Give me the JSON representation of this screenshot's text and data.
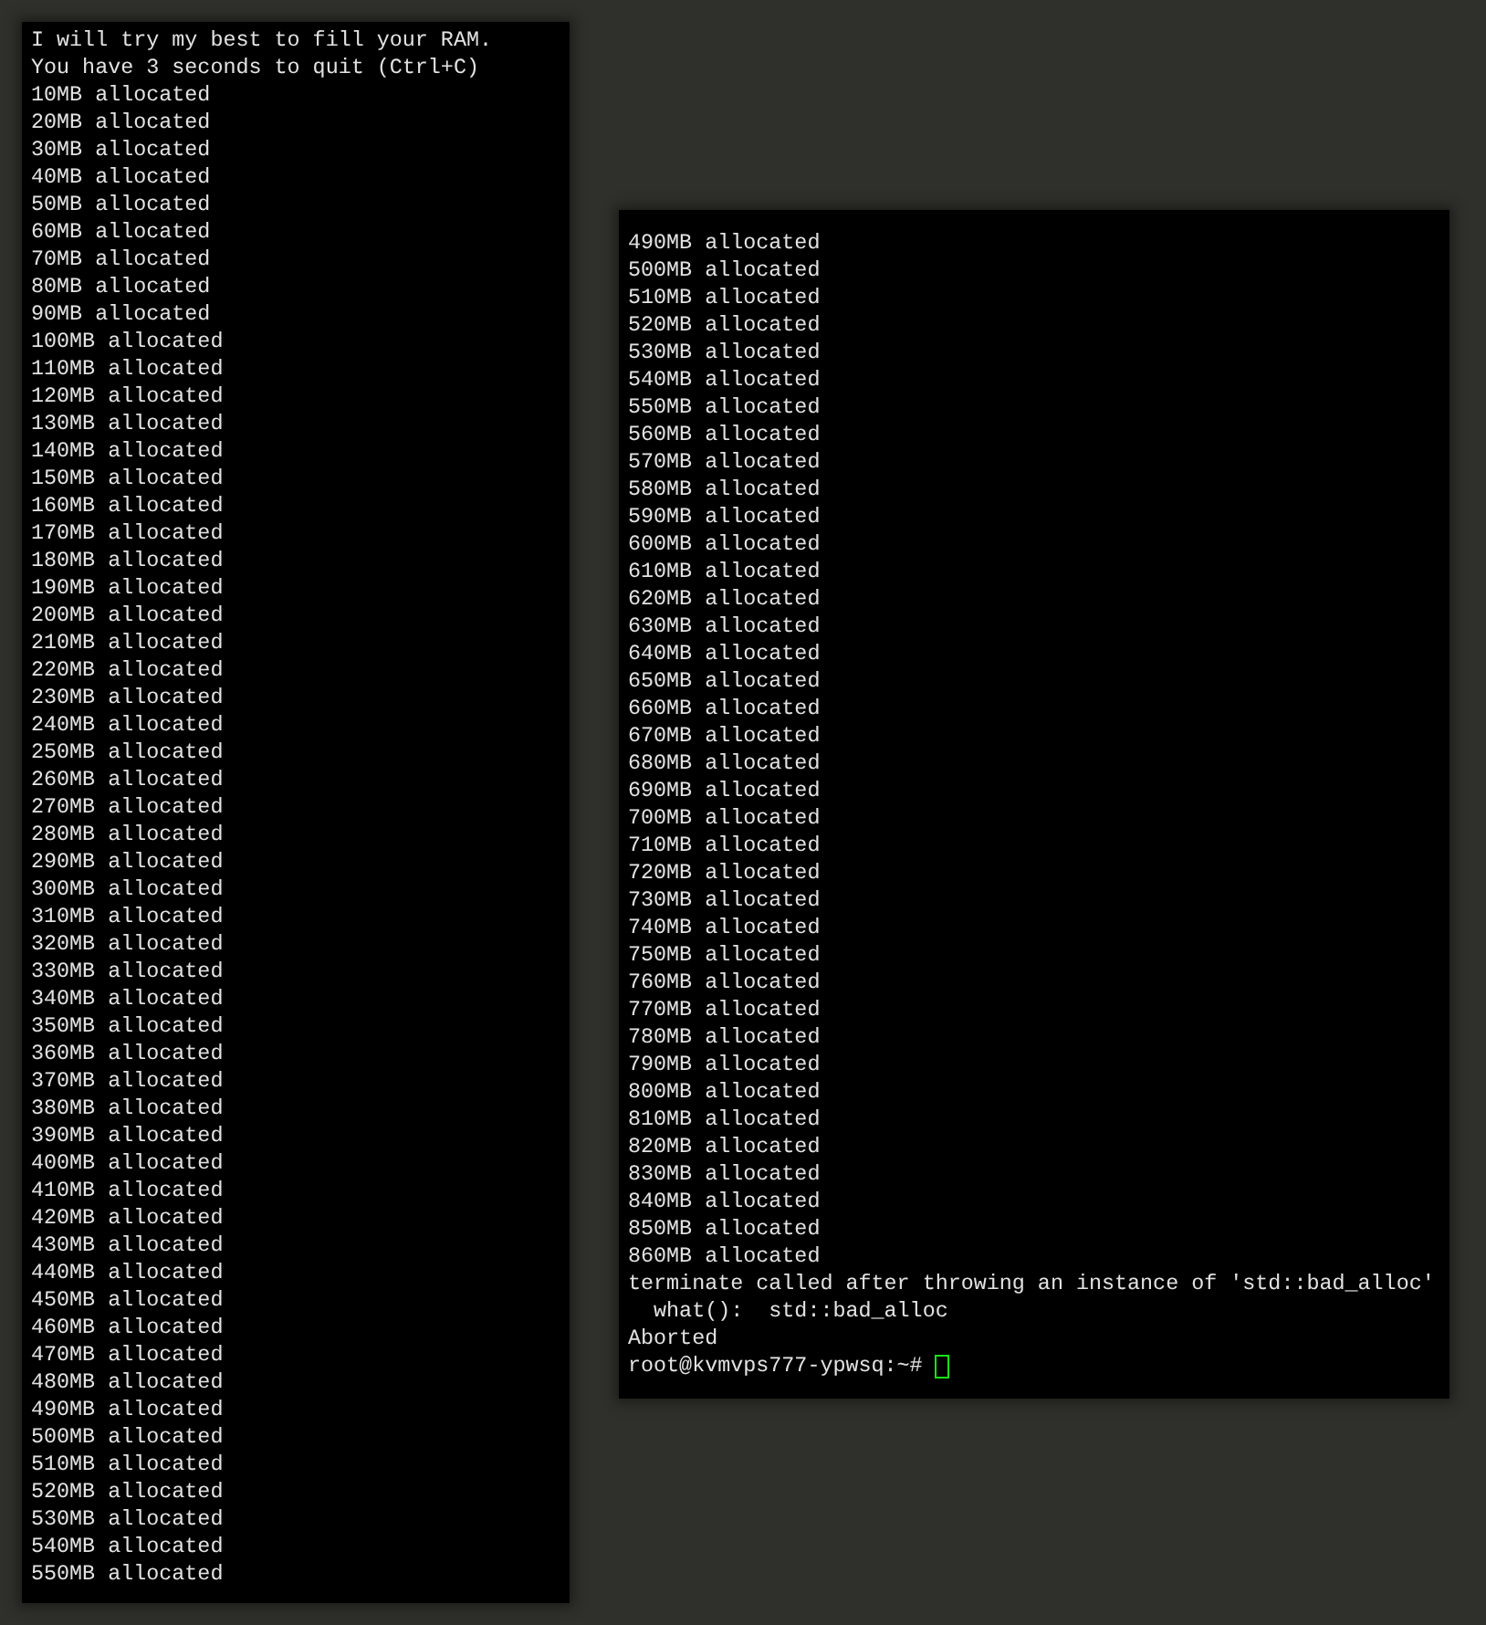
{
  "terminals": [
    {
      "lines": [
        "I will try my best to fill your RAM.",
        "You have 3 seconds to quit (Ctrl+C)",
        "10MB allocated",
        "20MB allocated",
        "30MB allocated",
        "40MB allocated",
        "50MB allocated",
        "60MB allocated",
        "70MB allocated",
        "80MB allocated",
        "90MB allocated",
        "100MB allocated",
        "110MB allocated",
        "120MB allocated",
        "130MB allocated",
        "140MB allocated",
        "150MB allocated",
        "160MB allocated",
        "170MB allocated",
        "180MB allocated",
        "190MB allocated",
        "200MB allocated",
        "210MB allocated",
        "220MB allocated",
        "230MB allocated",
        "240MB allocated",
        "250MB allocated",
        "260MB allocated",
        "270MB allocated",
        "280MB allocated",
        "290MB allocated",
        "300MB allocated",
        "310MB allocated",
        "320MB allocated",
        "330MB allocated",
        "340MB allocated",
        "350MB allocated",
        "360MB allocated",
        "370MB allocated",
        "380MB allocated",
        "390MB allocated",
        "400MB allocated",
        "410MB allocated",
        "420MB allocated",
        "430MB allocated",
        "440MB allocated",
        "450MB allocated",
        "460MB allocated",
        "470MB allocated",
        "480MB allocated",
        "490MB allocated",
        "500MB allocated",
        "510MB allocated",
        "520MB allocated",
        "530MB allocated",
        "540MB allocated",
        "550MB allocated"
      ]
    },
    {
      "lines": [
        "490MB allocated",
        "500MB allocated",
        "510MB allocated",
        "520MB allocated",
        "530MB allocated",
        "540MB allocated",
        "550MB allocated",
        "560MB allocated",
        "570MB allocated",
        "580MB allocated",
        "590MB allocated",
        "600MB allocated",
        "610MB allocated",
        "620MB allocated",
        "630MB allocated",
        "640MB allocated",
        "650MB allocated",
        "660MB allocated",
        "670MB allocated",
        "680MB allocated",
        "690MB allocated",
        "700MB allocated",
        "710MB allocated",
        "720MB allocated",
        "730MB allocated",
        "740MB allocated",
        "750MB allocated",
        "760MB allocated",
        "770MB allocated",
        "780MB allocated",
        "790MB allocated",
        "800MB allocated",
        "810MB allocated",
        "820MB allocated",
        "830MB allocated",
        "840MB allocated",
        "850MB allocated",
        "860MB allocated",
        "terminate called after throwing an instance of 'std::bad_alloc'",
        "  what():  std::bad_alloc",
        "Aborted",
        "root@kvmvps777-ypwsq:~# "
      ],
      "cursor": true
    }
  ]
}
